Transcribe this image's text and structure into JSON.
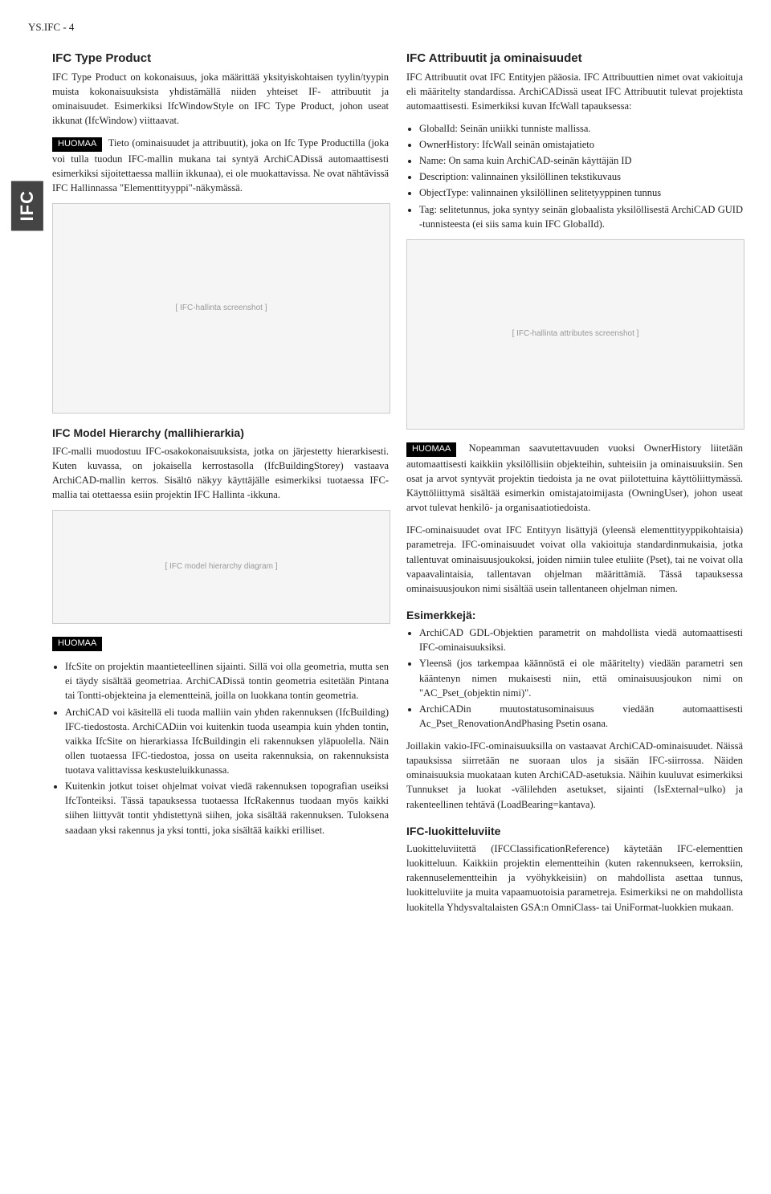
{
  "header": "YS.IFC - 4",
  "tab": "IFC",
  "c1": {
    "h1": "IFC Type Product",
    "p1": "IFC Type Product on kokonaisuus, joka määrittää yksityiskohtaisen tyylin/tyypin muista kokonaisuuksista yhdistämällä niiden yhteiset IF- attribuutit ja ominaisuudet. Esimerkiksi IfcWindowStyle on IFC Type Product, johon useat ikkunat (IfcWindow) viittaavat.",
    "n1": "HUOMAA",
    "p2": "Tieto (ominaisuudet ja attribuutit), joka on Ifc Type Productilla (joka voi tulla tuodun IFC-mallin mukana tai syntyä ArchiCADissä automaattisesti esimerkiksi sijoitettaessa malliin ikkunaa), ei ole muokattavissa. Ne ovat nähtävissä IFC Hallinnassa \"Elementtityyppi\"-näkymässä.",
    "h2": "IFC Model Hierarchy (mallihierarkia)",
    "p3": "IFC-malli muodostuu IFC-osakokonaisuuksista, jotka on järjestetty hierarkisesti. Kuten kuvassa, on jokaisella kerrostasolla (IfcBuildingStorey) vastaava ArchiCAD-mallin kerros. Sisältö näkyy käyttäjälle esimerkiksi tuotaessa IFC-mallia tai otettaessa esiin projektin IFC Hallinta -ikkuna.",
    "n2": "HUOMAA",
    "li1": "IfcSite on projektin maantieteellinen sijainti. Sillä voi olla geometria, mutta sen ei täydy sisältää geometriaa. ArchiCADissä tontin geometria esitetään Pintana tai Tontti-objekteina ja elementteinä, joilla on luokkana tontin geometria.",
    "li2": "ArchiCAD voi käsitellä eli tuoda malliin vain yhden rakennuksen (IfcBuilding) IFC-tiedostosta. ArchiCADiin voi kuitenkin tuoda useampia kuin yhden tontin, vaikka IfcSite on hierarkiassa IfcBuildingin eli rakennuksen yläpuolella. Näin ollen tuotaessa IFC-tiedostoa, jossa on useita rakennuksia, on rakennuksista tuotava valittavissa keskusteluikkunassa.",
    "li3": "Kuitenkin jotkut toiset ohjelmat voivat viedä rakennuksen topografian useiksi IfcTonteiksi. Tässä tapauksessa tuotaessa IfcRakennus tuodaan myös kaikki siihen liittyvät tontit yhdistettynä siihen, joka sisältää rakennuksen. Tuloksena saadaan yksi rakennus ja yksi tontti, joka sisältää kaikki erilliset."
  },
  "c2": {
    "h1": "IFC Attribuutit ja ominaisuudet",
    "p1": "IFC Attribuutit ovat IFC Entityjen pääosia. IFC Attribuuttien nimet ovat vakioituja eli määritelty standardissa. ArchiCADissä useat IFC Attribuutit tulevat projektista automaattisesti. Esimerkiksi kuvan IfcWall tapauksessa:",
    "li1": "GlobalId: Seinän uniikki tunniste mallissa.",
    "li2": "OwnerHistory: IfcWall seinän omistajatieto",
    "li3": "Name: On sama kuin ArchiCAD-seinän käyttäjän ID",
    "li4": "Description: valinnainen yksilöllinen tekstikuvaus",
    "li5": "ObjectType: valinnainen yksilöllinen selitetyyppinen tunnus",
    "li6": "Tag: selitetunnus, joka syntyy seinän globaalista yksilöllisestä ArchiCAD GUID -tunnisteesta (ei siis sama kuin IFC GlobalId).",
    "n1": "HUOMAA",
    "p2": "Nopeamman saavutettavuuden vuoksi OwnerHistory liitetään automaattisesti kaikkiin yksilöllisiin objekteihin, suhteisiin ja ominaisuuksiin. Sen osat ja arvot syntyvät projektin tiedoista ja ne ovat piilotettuina käyttöliittymässä. Käyttöliittymä sisältää esimerkin omistajatoimijasta (OwningUser), johon useat arvot tulevat henkilö- ja organisaatiotiedoista.",
    "p3": "IFC-ominaisuudet ovat IFC Entityyn lisättyjä (yleensä elementtityyppikohtaisia) parametreja. IFC-ominaisuudet voivat olla vakioituja standardinmukaisia, jotka tallentuvat ominaisuusjoukoksi, joiden nimiin tulee etuliite (Pset), tai ne voivat olla vapaavalintaisia, tallentavan ohjelman määrittämiä. Tässä tapauksessa ominaisuusjoukon nimi sisältää usein tallentaneen ohjelman nimen.",
    "h2": "Esimerkkejä:",
    "li7": "ArchiCAD GDL-Objektien parametrit on mahdollista viedä automaattisesti IFC-ominaisuuksiksi.",
    "li8": "Yleensä (jos tarkempaa käännöstä ei ole määritelty) viedään parametri sen kääntenyn nimen mukaisesti niin, että ominaisuusjoukon nimi on \"AC_Pset_(objektin nimi)\".",
    "li9": "ArchiCADin muutostatusominaisuus viedään automaattisesti Ac_Pset_RenovationAndPhasing Psetin osana.",
    "p4": "Joillakin vakio-IFC-ominaisuuksilla on vastaavat ArchiCAD-ominaisuudet. Näissä tapauksissa siirretään ne suoraan ulos ja sisään IFC-siirrossa. Näiden ominaisuuksia muokataan kuten ArchiCAD-asetuksia. Näihin kuuluvat esimerkiksi Tunnukset ja luokat -välilehden asetukset, sijainti (IsExternal=ulko) ja rakenteellinen tehtävä (LoadBearing=kantava).",
    "h3": "IFC-luokitteluviite",
    "p5": "Luokitteluviitettä (IFCClassificationReference) käytetään IFC-elementtien luokitteluun. Kaikkiin projektin elementteihin (kuten rakennukseen, kerroksiin, rakennuselementteihin ja vyöhykkeisiin) on mahdollista asettaa tunnus, luokitteluviite ja muita vapaamuotoisia parametreja. Esimerkiksi ne on mahdollista luokitella Yhdysvaltalaisten GSA:n OmniClass- tai UniFormat-luokkien mukaan."
  }
}
